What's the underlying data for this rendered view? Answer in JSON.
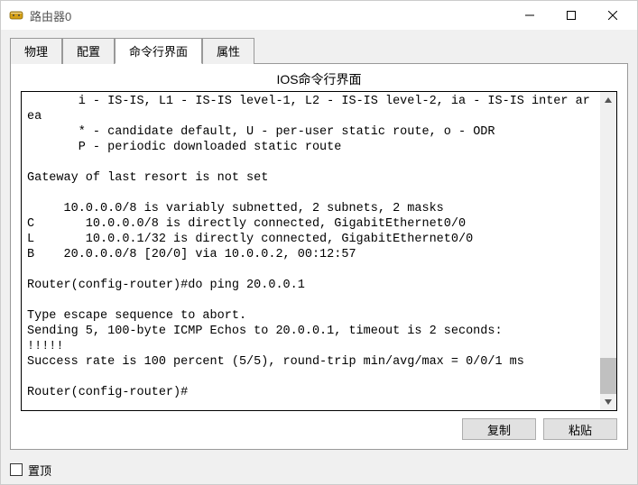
{
  "window": {
    "title": "路由器0"
  },
  "tabs": {
    "physical": "物理",
    "config": "配置",
    "cli": "命令行界面",
    "attributes": "属性"
  },
  "panel": {
    "title": "IOS命令行界面"
  },
  "terminal": {
    "content": "       i - IS-IS, L1 - IS-IS level-1, L2 - IS-IS level-2, ia - IS-IS inter area\n       * - candidate default, U - per-user static route, o - ODR\n       P - periodic downloaded static route\n\nGateway of last resort is not set\n\n     10.0.0.0/8 is variably subnetted, 2 subnets, 2 masks\nC       10.0.0.0/8 is directly connected, GigabitEthernet0/0\nL       10.0.0.1/32 is directly connected, GigabitEthernet0/0\nB    20.0.0.0/8 [20/0] via 10.0.0.2, 00:12:57\n\nRouter(config-router)#do ping 20.0.0.1\n\nType escape sequence to abort.\nSending 5, 100-byte ICMP Echos to 20.0.0.1, timeout is 2 seconds:\n!!!!!\nSuccess rate is 100 percent (5/5), round-trip min/avg/max = 0/0/1 ms\n\nRouter(config-router)#"
  },
  "buttons": {
    "copy": "复制",
    "paste": "粘贴"
  },
  "footer": {
    "ontop": "置顶"
  }
}
